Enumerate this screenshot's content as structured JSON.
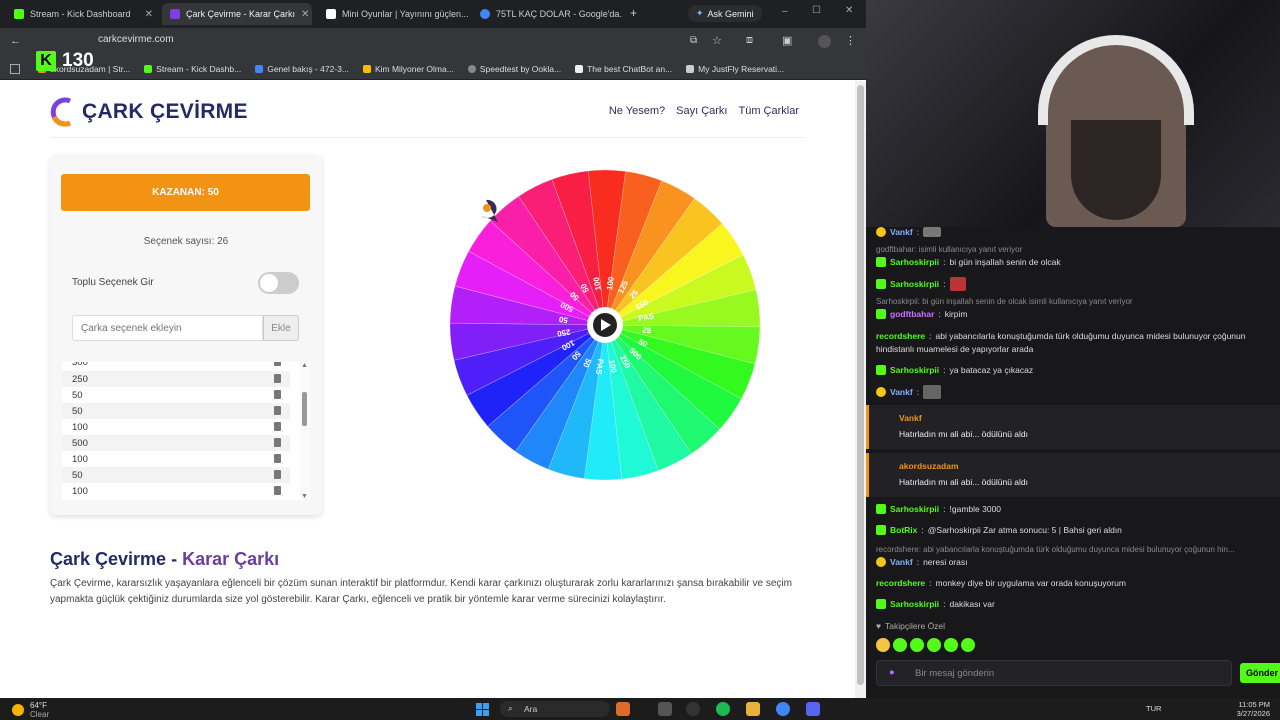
{
  "browser": {
    "tabs": [
      {
        "label": "Stream - Kick Dashboard",
        "color": "#53fc18"
      },
      {
        "label": "Çark Çevirme - Karar Çarkı",
        "color": "#7b3fe4"
      },
      {
        "label": "Mini Oyunlar | Yayınını güçlen...",
        "color": "#ffffff"
      },
      {
        "label": "75TL KAÇ DOLAR - Google'da...",
        "color": "#4285f4"
      }
    ],
    "ask_gemini": "Ask Gemini",
    "url": "carkcevirme.com",
    "bookmarks": [
      "akordsuzadam | Str...",
      "Stream - Kick Dashb...",
      "Genel bakış - 472-3...",
      "Kim Milyoner Olma...",
      "Speedtest by Ookla...",
      "The best ChatBot an...",
      "My JustFly Reservati..."
    ]
  },
  "site": {
    "logo_text": "ÇARK ÇEVİRME",
    "nav": [
      "Ne Yesem?",
      "Sayı Çarkı",
      "Tüm Çarklar"
    ],
    "winner": "KAZANAN: 50",
    "option_count": "Seçenek sayısı: 26",
    "bulk_label": "Toplu Seçenek Gir",
    "bulk_enabled": false,
    "input_placeholder": "Çarka seçenek ekleyin",
    "add_button": "Ekle",
    "options_visible": [
      "300",
      "250",
      "50",
      "50",
      "100",
      "500",
      "100",
      "50",
      "100"
    ],
    "wheel_labels": [
      "100",
      "100",
      "125",
      "25",
      "150",
      "PAS",
      "25",
      "50",
      "500",
      "250",
      "100",
      "PAS",
      "50",
      "50",
      "100",
      "250",
      "50",
      "500",
      "50",
      "50"
    ],
    "heading_main": "Çark Çevirme -",
    "heading_highlight": "Karar Çarkı",
    "paragraph": "Çark Çevirme, kararsızlık yaşayanlara eğlenceli bir çözüm sunan interaktif bir platformdur. Kendi karar çarkınızı oluşturarak zorlu kararlarınızı şansa bırakabilir ve seçim yapmakta güçlük çektiğiniz durumlarda size yol gösterebilir. Karar Çarkı, eğlenceli ve pratik bir yöntemle karar verme sürecinizi kolaylaştırır."
  },
  "stream": {
    "viewer_count": "130",
    "chat": [
      {
        "user": "Vankf",
        "text": "",
        "color": "#7fb3ff"
      },
      {
        "reply": "godftbahar: isimli kullanıcıya yanıt veriyor"
      },
      {
        "user": "Sarhoskirpii",
        "text": "bi gün inşallah senin de olcak",
        "color": "#53fc18"
      },
      {
        "user": "Sarhoskirpii",
        "text": "",
        "color": "#53fc18"
      },
      {
        "reply": "Sarhoskirpii: bi gün inşallah senin de olcak isimli kullanıcıya yanıt veriyor"
      },
      {
        "user": "godftbahar",
        "text": "kirpim",
        "color": "#d06fff"
      },
      {
        "user": "recordshere",
        "text": "abi yabancılarla konuştuğumda türk olduğumu duyunca midesi bulunuyor çoğunun",
        "color": "#53fc18"
      },
      {
        "cont": "hindistanlı muamelesi de yapıyorlar arada"
      },
      {
        "user": "Sarhoskirpii",
        "text": "ya batacaz ya çıkacaz",
        "color": "#53fc18"
      },
      {
        "user": "Vankf",
        "text": "",
        "color": "#7fb3ff"
      },
      {
        "user": "Sarhoskirpii",
        "text": "!gamble 3000",
        "color": "#53fc18"
      },
      {
        "user": "BotRix",
        "text": "@Sarhoskirpii Zar atma sonucu: 5 | Bahsi geri aldın",
        "color": "#53fc18"
      },
      {
        "reply": "recordshere: abi yabancılarla konuştuğumda türk olduğumu duyunca midesi bulunuyor çoğunun hin..."
      },
      {
        "user": "Vankf",
        "text": "neresi orası",
        "color": "#7fb3ff"
      },
      {
        "user": "recordshere",
        "text": "monkey diye bir uygulama var orada konuşuyorum",
        "color": "#53fc18"
      },
      {
        "user": "Sarhoskirpii",
        "text": "dakikası var",
        "color": "#53fc18"
      }
    ],
    "rewards": [
      {
        "user": "Vankf",
        "text": "Hatırladın mı ali abi... ödülünü aldı"
      },
      {
        "user": "akordsuzadam",
        "text": "Hatırladın mı ali abi... ödülünü aldı"
      }
    ],
    "followers_label": "Takipçilere Özel",
    "chat_placeholder": "Bir mesaj gönderin",
    "send_label": "Gönder"
  },
  "taskbar": {
    "weather_temp": "64°F",
    "weather_desc": "Clear",
    "search": "Ara",
    "lang": "TUR",
    "time": "11:05 PM",
    "date": "3/27/2026"
  }
}
